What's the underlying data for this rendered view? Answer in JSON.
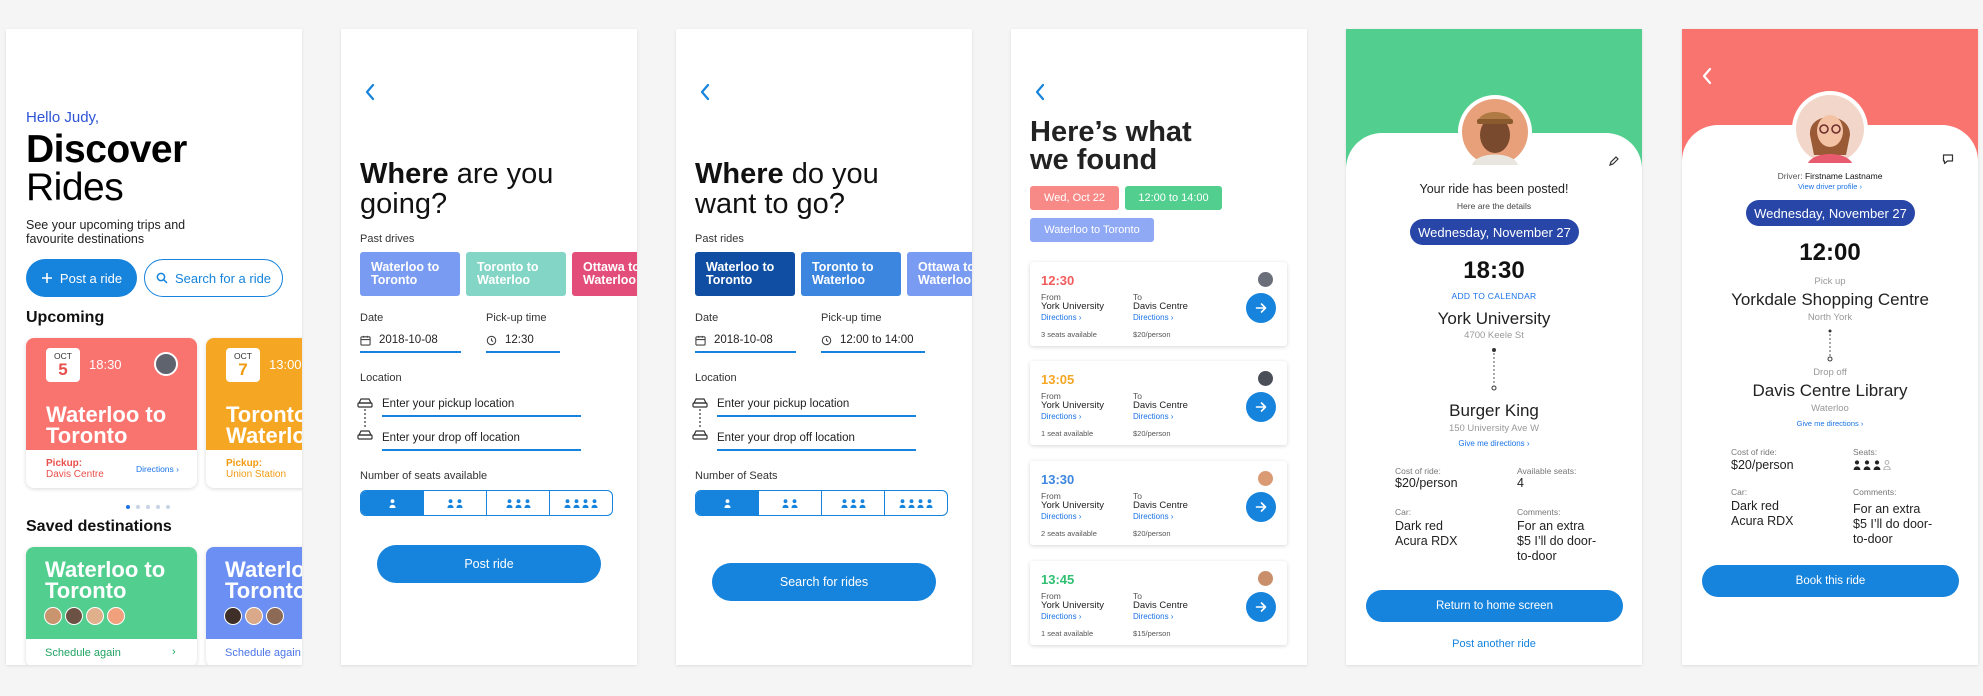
{
  "screen1": {
    "greeting": "Hello Judy,",
    "title_bold": "Discover",
    "title_light": "Rides",
    "subtitle": "See your upcoming trips and favourite destinations",
    "post_ride_label": "Post a ride",
    "search_ride_label": "Search for a ride",
    "upcoming_heading": "Upcoming",
    "upcoming": [
      {
        "month": "OCT",
        "day": "5",
        "time": "18:30",
        "title": "Waterloo to Toronto",
        "pickup_label": "Pickup:",
        "pickup_place": "Davis Centre",
        "directions": "Directions ›",
        "color": "#f9736f",
        "accent": "#e8504c"
      },
      {
        "month": "OCT",
        "day": "7",
        "time": "13:00",
        "title": "Toronto to Waterloo",
        "pickup_label": "Pickup:",
        "pickup_place": "Union Station",
        "directions": "",
        "color": "#f5a623",
        "accent": "#f09a10"
      }
    ],
    "saved_heading": "Saved destinations",
    "saved": [
      {
        "title": "Waterloo to Toronto",
        "action": "Schedule again",
        "chevron": "›",
        "color": "#52cf8e",
        "action_color": "#1fa361"
      },
      {
        "title": "Waterloo to Toronto",
        "action": "Schedule again",
        "chevron": "",
        "color": "#6b8ff2",
        "action_color": "#4a74e8"
      }
    ]
  },
  "screen2": {
    "title_bold": "Where",
    "title_rest": " are you going?",
    "past_label": "Past drives",
    "chips": [
      {
        "label": "Waterloo to Toronto",
        "color": "#7a9bf2"
      },
      {
        "label": "Toronto to Waterloo",
        "color": "#83d6c6"
      },
      {
        "label": "Ottawa to Waterloo",
        "color": "#e34d7a"
      }
    ],
    "date_label": "Date",
    "date_value": "2018-10-08",
    "time_label": "Pick-up time",
    "time_value": "12:30",
    "location_label": "Location",
    "pickup_placeholder": "Enter your pickup location",
    "dropoff_placeholder": "Enter your drop off location",
    "seats_label": "Number of seats available",
    "button": "Post ride"
  },
  "screen3": {
    "title_bold": "Where",
    "title_rest": " do you want to go?",
    "past_label": "Past rides",
    "chips": [
      {
        "label": "Waterloo to Toronto",
        "color": "#0f4ea3"
      },
      {
        "label": "Toronto to Waterloo",
        "color": "#3d86e0"
      },
      {
        "label": "Ottawa to Waterloo",
        "color": "#7a9bf2"
      }
    ],
    "date_label": "Date",
    "date_value": "2018-10-08",
    "time_label": "Pick-up time",
    "time_value": "12:00 to 14:00",
    "location_label": "Location",
    "pickup_placeholder": "Enter your pickup location",
    "dropoff_placeholder": "Enter your drop off location",
    "seats_label": "Number of Seats",
    "button": "Search for rides"
  },
  "screen4": {
    "title_line1": "Here’s what",
    "title_line2": "we found",
    "tags": [
      {
        "label": "Wed, Oct 22",
        "bg": "#f78a86",
        "fg": "#ffffff"
      },
      {
        "label": "12:00 to 14:00",
        "bg": "#52cf8e",
        "fg": "#ffffff"
      },
      {
        "label": "Waterloo to Toronto",
        "bg": "#8fa9f5",
        "fg": "#ffffff"
      }
    ],
    "from_label": "From",
    "to_label": "To",
    "results": [
      {
        "time": "12:30",
        "color": "#f25c5c",
        "from": "York University",
        "to": "Davis Centre",
        "directions": "Directions ›",
        "seats": "3 seats available",
        "price": "$20/person",
        "avatar": "#6b6f7a"
      },
      {
        "time": "13:05",
        "color": "#f5a623",
        "from": "York University",
        "to": "Davis Centre",
        "directions": "Directions ›",
        "seats": "1 seat available",
        "price": "$20/person",
        "avatar": "#4a4f58"
      },
      {
        "time": "13:30",
        "color": "#3d86e0",
        "from": "York University",
        "to": "Davis Centre",
        "directions": "Directions ›",
        "seats": "2 seats available",
        "price": "$20/person",
        "avatar": "#d99a74"
      },
      {
        "time": "13:45",
        "color": "#2fbf71",
        "from": "York University",
        "to": "Davis Centre",
        "directions": "Directions ›",
        "seats": "1 seat available",
        "price": "$15/person",
        "avatar": "#c98f6a"
      }
    ]
  },
  "screen5": {
    "header_color": "#52cf8e",
    "posted": "Your ride has been posted!",
    "details": "Here are the details",
    "day": "Wednesday, November 27",
    "time": "18:30",
    "calendar": "ADD TO CALENDAR",
    "origin": "York University",
    "origin_addr": "4700 Keele St",
    "destination": "Burger King",
    "dest_addr": "150 University Ave W",
    "directions": "Give me directions ›",
    "cost_label": "Cost of ride:",
    "cost": "$20/person",
    "seats_label": "Available seats:",
    "seats": "4",
    "car_label": "Car:",
    "car": "Dark red Acura RDX",
    "comments_label": "Comments:",
    "comments": "For an extra $5 I’ll do door-to-door",
    "primary": "Return to home screen",
    "secondary": "Post another ride"
  },
  "screen6": {
    "header_color": "#f9736f",
    "driver_label": "Driver: ",
    "driver_name": "Firstname Lastname",
    "profile_link": "View driver profile ›",
    "day": "Wednesday, November 27",
    "time": "12:00",
    "pickup_label": "Pick up",
    "pickup": "Yorkdale Shopping Centre",
    "pickup_area": "North York",
    "dropoff_label": "Drop off",
    "dropoff": "Davis Centre Library",
    "dropoff_area": "Waterloo",
    "directions": "Give me directions ›",
    "cost_label": "Cost of ride:",
    "cost": "$20/person",
    "seats_label": "Seats:",
    "car_label": "Car:",
    "car": "Dark red Acura RDX",
    "comments_label": "Comments:",
    "comments": "For an extra $5 I’ll do door-to-door",
    "button": "Book this ride"
  }
}
